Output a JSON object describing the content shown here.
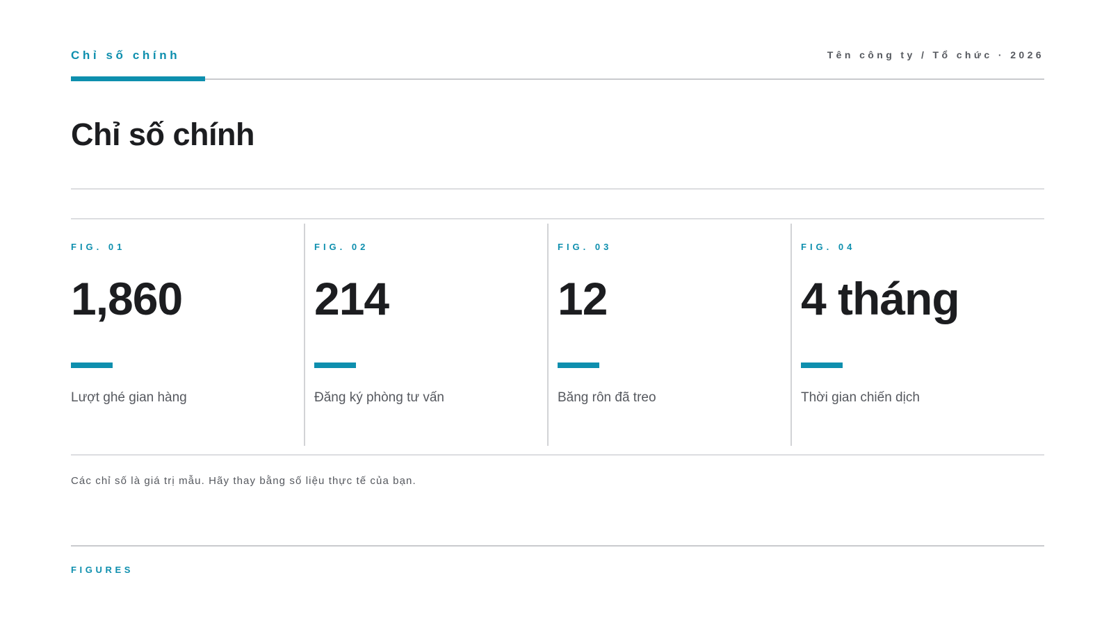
{
  "header": {
    "kicker": "Chỉ số chính",
    "organization": "Tên công ty / Tổ chức · 2026"
  },
  "title": "Chỉ số chính",
  "metrics": [
    {
      "fig": "FIG. 01",
      "value": "1,860",
      "label": "Lượt ghé gian hàng"
    },
    {
      "fig": "FIG. 02",
      "value": "214",
      "label": "Đăng ký phòng tư vấn"
    },
    {
      "fig": "FIG. 03",
      "value": "12",
      "label": "Băng rôn đã treo"
    },
    {
      "fig": "FIG. 04",
      "value": "4 tháng",
      "label": "Thời gian chiến dịch"
    }
  ],
  "footnote": "Các chỉ số là giá trị mẫu. Hãy thay bằng số liệu thực tế của bạn.",
  "footer": {
    "label": "FIGURES"
  },
  "colors": {
    "accent": "#0e8fae",
    "text": "#1c1d20",
    "muted": "#55585e",
    "rule": "#dcdde0"
  }
}
